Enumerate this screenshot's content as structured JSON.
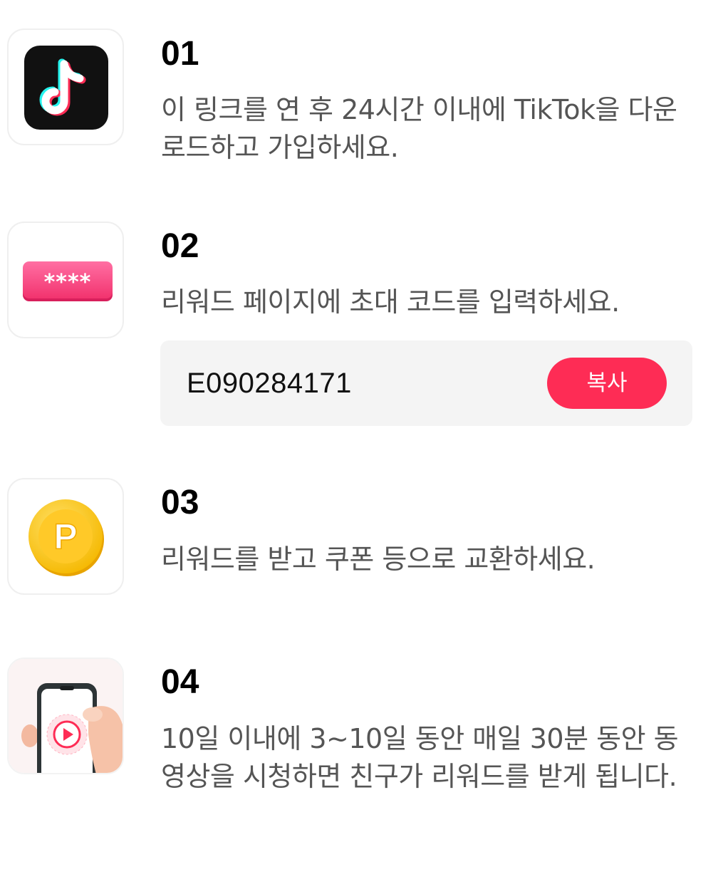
{
  "steps": [
    {
      "number": "01",
      "text": "이 링크를 연 후 24시간 이내에 TikTok을 다운로드하고 가입하세요.",
      "icon": "tiktok-logo-icon"
    },
    {
      "number": "02",
      "text": "리워드 페이지에 초대 코드를 입력하세요.",
      "icon": "password-field-icon",
      "icon_text": "****",
      "invite_code": "E090284171",
      "copy_label": "복사"
    },
    {
      "number": "03",
      "text": "리워드를 받고 쿠폰 등으로 교환하세요.",
      "icon": "coin-p-icon",
      "icon_text": "P"
    },
    {
      "number": "04",
      "text": "10일 이내에 3~10일 동안 매일 30분 동안 동영상을 시청하면 친구가 리워드를 받게 됩니다.",
      "icon": "phone-video-icon"
    }
  ],
  "colors": {
    "accent": "#fe2c55",
    "text_primary": "#000000",
    "text_secondary": "#555555",
    "code_bg": "#f4f4f4"
  }
}
